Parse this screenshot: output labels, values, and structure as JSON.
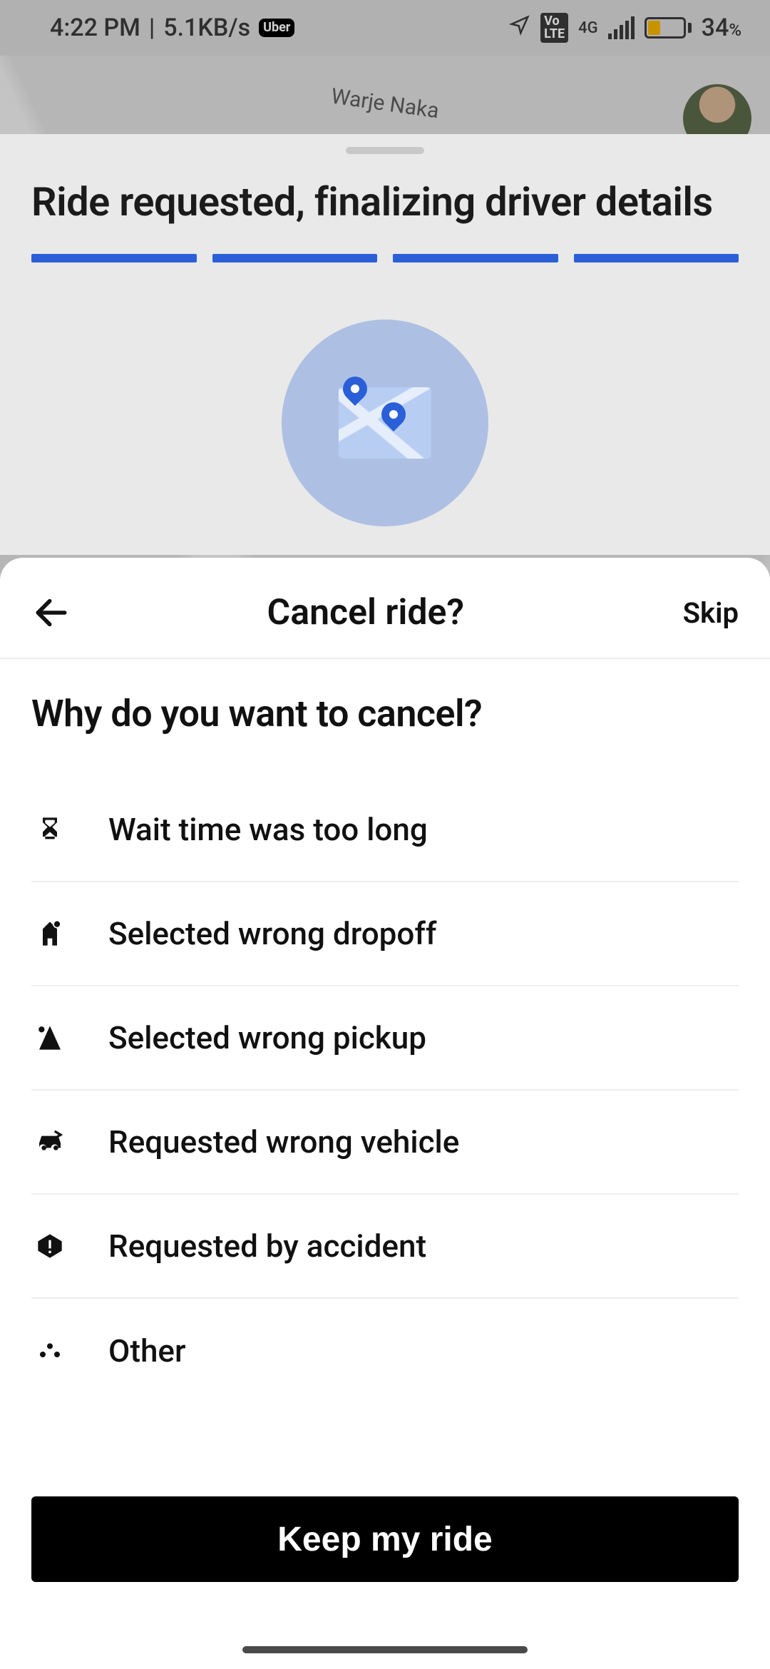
{
  "status_bar": {
    "time": "4:22 PM",
    "net_speed": "5.1KB/s",
    "app_badge": "Uber",
    "volte": "Vo LTE",
    "network_type": "4G",
    "battery_pct": "34",
    "battery_sym": "%"
  },
  "map": {
    "location_label": "Warje Naka"
  },
  "status_sheet": {
    "title": "Ride requested, finalizing driver details"
  },
  "modal": {
    "title": "Cancel ride?",
    "skip": "Skip",
    "question": "Why do you want to cancel?",
    "reasons": [
      {
        "icon": "hourglass-icon",
        "label": "Wait time was too long"
      },
      {
        "icon": "wrong-dropoff-icon",
        "label": "Selected wrong dropoff"
      },
      {
        "icon": "wrong-pickup-icon",
        "label": "Selected wrong pickup"
      },
      {
        "icon": "wrong-vehicle-icon",
        "label": "Requested wrong vehicle"
      },
      {
        "icon": "accident-icon",
        "label": "Requested by accident"
      },
      {
        "icon": "other-icon",
        "label": "Other"
      }
    ],
    "cta": "Keep my ride"
  }
}
